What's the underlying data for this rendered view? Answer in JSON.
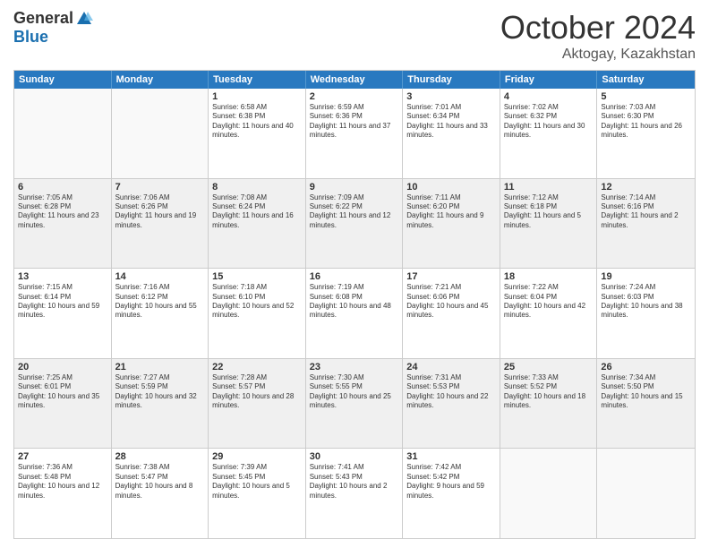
{
  "logo": {
    "general": "General",
    "blue": "Blue"
  },
  "title": "October 2024",
  "location": "Aktogay, Kazakhstan",
  "days": [
    "Sunday",
    "Monday",
    "Tuesday",
    "Wednesday",
    "Thursday",
    "Friday",
    "Saturday"
  ],
  "rows": [
    [
      {
        "day": "",
        "empty": true
      },
      {
        "day": "",
        "empty": true
      },
      {
        "day": "1",
        "sunrise": "Sunrise: 6:58 AM",
        "sunset": "Sunset: 6:38 PM",
        "daylight": "Daylight: 11 hours and 40 minutes."
      },
      {
        "day": "2",
        "sunrise": "Sunrise: 6:59 AM",
        "sunset": "Sunset: 6:36 PM",
        "daylight": "Daylight: 11 hours and 37 minutes."
      },
      {
        "day": "3",
        "sunrise": "Sunrise: 7:01 AM",
        "sunset": "Sunset: 6:34 PM",
        "daylight": "Daylight: 11 hours and 33 minutes."
      },
      {
        "day": "4",
        "sunrise": "Sunrise: 7:02 AM",
        "sunset": "Sunset: 6:32 PM",
        "daylight": "Daylight: 11 hours and 30 minutes."
      },
      {
        "day": "5",
        "sunrise": "Sunrise: 7:03 AM",
        "sunset": "Sunset: 6:30 PM",
        "daylight": "Daylight: 11 hours and 26 minutes."
      }
    ],
    [
      {
        "day": "6",
        "sunrise": "Sunrise: 7:05 AM",
        "sunset": "Sunset: 6:28 PM",
        "daylight": "Daylight: 11 hours and 23 minutes."
      },
      {
        "day": "7",
        "sunrise": "Sunrise: 7:06 AM",
        "sunset": "Sunset: 6:26 PM",
        "daylight": "Daylight: 11 hours and 19 minutes."
      },
      {
        "day": "8",
        "sunrise": "Sunrise: 7:08 AM",
        "sunset": "Sunset: 6:24 PM",
        "daylight": "Daylight: 11 hours and 16 minutes."
      },
      {
        "day": "9",
        "sunrise": "Sunrise: 7:09 AM",
        "sunset": "Sunset: 6:22 PM",
        "daylight": "Daylight: 11 hours and 12 minutes."
      },
      {
        "day": "10",
        "sunrise": "Sunrise: 7:11 AM",
        "sunset": "Sunset: 6:20 PM",
        "daylight": "Daylight: 11 hours and 9 minutes."
      },
      {
        "day": "11",
        "sunrise": "Sunrise: 7:12 AM",
        "sunset": "Sunset: 6:18 PM",
        "daylight": "Daylight: 11 hours and 5 minutes."
      },
      {
        "day": "12",
        "sunrise": "Sunrise: 7:14 AM",
        "sunset": "Sunset: 6:16 PM",
        "daylight": "Daylight: 11 hours and 2 minutes."
      }
    ],
    [
      {
        "day": "13",
        "sunrise": "Sunrise: 7:15 AM",
        "sunset": "Sunset: 6:14 PM",
        "daylight": "Daylight: 10 hours and 59 minutes."
      },
      {
        "day": "14",
        "sunrise": "Sunrise: 7:16 AM",
        "sunset": "Sunset: 6:12 PM",
        "daylight": "Daylight: 10 hours and 55 minutes."
      },
      {
        "day": "15",
        "sunrise": "Sunrise: 7:18 AM",
        "sunset": "Sunset: 6:10 PM",
        "daylight": "Daylight: 10 hours and 52 minutes."
      },
      {
        "day": "16",
        "sunrise": "Sunrise: 7:19 AM",
        "sunset": "Sunset: 6:08 PM",
        "daylight": "Daylight: 10 hours and 48 minutes."
      },
      {
        "day": "17",
        "sunrise": "Sunrise: 7:21 AM",
        "sunset": "Sunset: 6:06 PM",
        "daylight": "Daylight: 10 hours and 45 minutes."
      },
      {
        "day": "18",
        "sunrise": "Sunrise: 7:22 AM",
        "sunset": "Sunset: 6:04 PM",
        "daylight": "Daylight: 10 hours and 42 minutes."
      },
      {
        "day": "19",
        "sunrise": "Sunrise: 7:24 AM",
        "sunset": "Sunset: 6:03 PM",
        "daylight": "Daylight: 10 hours and 38 minutes."
      }
    ],
    [
      {
        "day": "20",
        "sunrise": "Sunrise: 7:25 AM",
        "sunset": "Sunset: 6:01 PM",
        "daylight": "Daylight: 10 hours and 35 minutes."
      },
      {
        "day": "21",
        "sunrise": "Sunrise: 7:27 AM",
        "sunset": "Sunset: 5:59 PM",
        "daylight": "Daylight: 10 hours and 32 minutes."
      },
      {
        "day": "22",
        "sunrise": "Sunrise: 7:28 AM",
        "sunset": "Sunset: 5:57 PM",
        "daylight": "Daylight: 10 hours and 28 minutes."
      },
      {
        "day": "23",
        "sunrise": "Sunrise: 7:30 AM",
        "sunset": "Sunset: 5:55 PM",
        "daylight": "Daylight: 10 hours and 25 minutes."
      },
      {
        "day": "24",
        "sunrise": "Sunrise: 7:31 AM",
        "sunset": "Sunset: 5:53 PM",
        "daylight": "Daylight: 10 hours and 22 minutes."
      },
      {
        "day": "25",
        "sunrise": "Sunrise: 7:33 AM",
        "sunset": "Sunset: 5:52 PM",
        "daylight": "Daylight: 10 hours and 18 minutes."
      },
      {
        "day": "26",
        "sunrise": "Sunrise: 7:34 AM",
        "sunset": "Sunset: 5:50 PM",
        "daylight": "Daylight: 10 hours and 15 minutes."
      }
    ],
    [
      {
        "day": "27",
        "sunrise": "Sunrise: 7:36 AM",
        "sunset": "Sunset: 5:48 PM",
        "daylight": "Daylight: 10 hours and 12 minutes."
      },
      {
        "day": "28",
        "sunrise": "Sunrise: 7:38 AM",
        "sunset": "Sunset: 5:47 PM",
        "daylight": "Daylight: 10 hours and 8 minutes."
      },
      {
        "day": "29",
        "sunrise": "Sunrise: 7:39 AM",
        "sunset": "Sunset: 5:45 PM",
        "daylight": "Daylight: 10 hours and 5 minutes."
      },
      {
        "day": "30",
        "sunrise": "Sunrise: 7:41 AM",
        "sunset": "Sunset: 5:43 PM",
        "daylight": "Daylight: 10 hours and 2 minutes."
      },
      {
        "day": "31",
        "sunrise": "Sunrise: 7:42 AM",
        "sunset": "Sunset: 5:42 PM",
        "daylight": "Daylight: 9 hours and 59 minutes."
      },
      {
        "day": "",
        "empty": true
      },
      {
        "day": "",
        "empty": true
      }
    ]
  ]
}
